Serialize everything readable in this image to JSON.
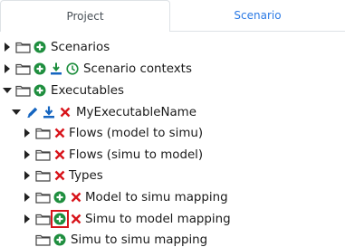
{
  "tabs": [
    {
      "label": "Project",
      "active": true
    },
    {
      "label": "Scenario",
      "active": false
    }
  ],
  "tree": {
    "scenarios": "Scenarios",
    "scenario_contexts": "Scenario contexts",
    "executables": "Executables",
    "executable_name": "MyExecutableName",
    "flows_model_to_simu": "Flows (model to simu)",
    "flows_simu_to_model": "Flows (simu to model)",
    "types": "Types",
    "model_to_simu_mapping": "Model to simu mapping",
    "simu_to_model_mapping": "Simu to model mapping",
    "simu_to_simu_mapping": "Simu to simu mapping"
  },
  "colors": {
    "add_green": "#1e8e3e",
    "delete_red": "#d8141b",
    "action_blue": "#1565c0",
    "tab_active_text": "#495057",
    "tab_link_text": "#2c7be5",
    "highlight_border": "#d8141b"
  },
  "icons": {
    "expand": "caret-right-icon",
    "collapse": "caret-down-icon",
    "folder": "folder-icon",
    "add": "add-circle-icon",
    "remove": "delete-x-icon",
    "edit": "pencil-icon",
    "download": "download-icon",
    "import": "import-icon",
    "history": "clock-icon"
  }
}
